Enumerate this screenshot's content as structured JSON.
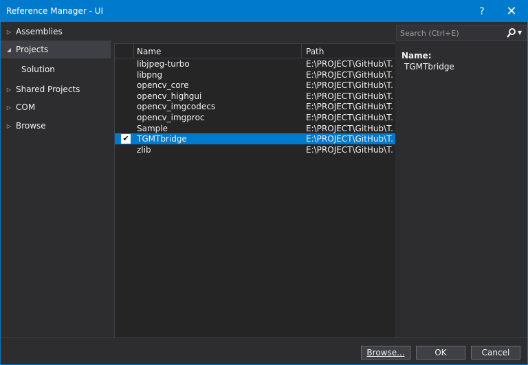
{
  "window": {
    "title": "Reference Manager - UI",
    "help_glyph": "?",
    "close_glyph": "✕"
  },
  "nav": {
    "items": [
      {
        "label": "Assemblies",
        "expanded": false,
        "selected": false
      },
      {
        "label": "Projects",
        "expanded": true,
        "selected": true
      },
      {
        "label": "Solution",
        "sub": true
      },
      {
        "label": "Shared Projects",
        "expanded": false
      },
      {
        "label": "COM",
        "expanded": false
      },
      {
        "label": "Browse",
        "expanded": false
      }
    ]
  },
  "search": {
    "placeholder": "Search (Ctrl+E)"
  },
  "list": {
    "columns": {
      "name": "Name",
      "path": "Path"
    },
    "rows": [
      {
        "name": "libjpeg-turbo",
        "path": "E:\\PROJECT\\GitHub\\T...",
        "checked": false
      },
      {
        "name": "libpng",
        "path": "E:\\PROJECT\\GitHub\\T...",
        "checked": false
      },
      {
        "name": "opencv_core",
        "path": "E:\\PROJECT\\GitHub\\T...",
        "checked": false
      },
      {
        "name": "opencv_highgui",
        "path": "E:\\PROJECT\\GitHub\\T...",
        "checked": false
      },
      {
        "name": "opencv_imgcodecs",
        "path": "E:\\PROJECT\\GitHub\\T...",
        "checked": false
      },
      {
        "name": "opencv_imgproc",
        "path": "E:\\PROJECT\\GitHub\\T...",
        "checked": false
      },
      {
        "name": "Sample",
        "path": "E:\\PROJECT\\GitHub\\T...",
        "checked": false
      },
      {
        "name": "TGMTbridge",
        "path": "E:\\PROJECT\\GitHub\\T...",
        "checked": true
      },
      {
        "name": "zlib",
        "path": "E:\\PROJECT\\GitHub\\T...",
        "checked": false
      }
    ]
  },
  "detail": {
    "name_label": "Name:",
    "name_value": "TGMTbridge"
  },
  "footer": {
    "browse_label": "Browse...",
    "ok_label": "OK",
    "cancel_label": "Cancel"
  },
  "colors": {
    "accent": "#007acc",
    "background": "#2d2d30",
    "panel": "#252526"
  }
}
